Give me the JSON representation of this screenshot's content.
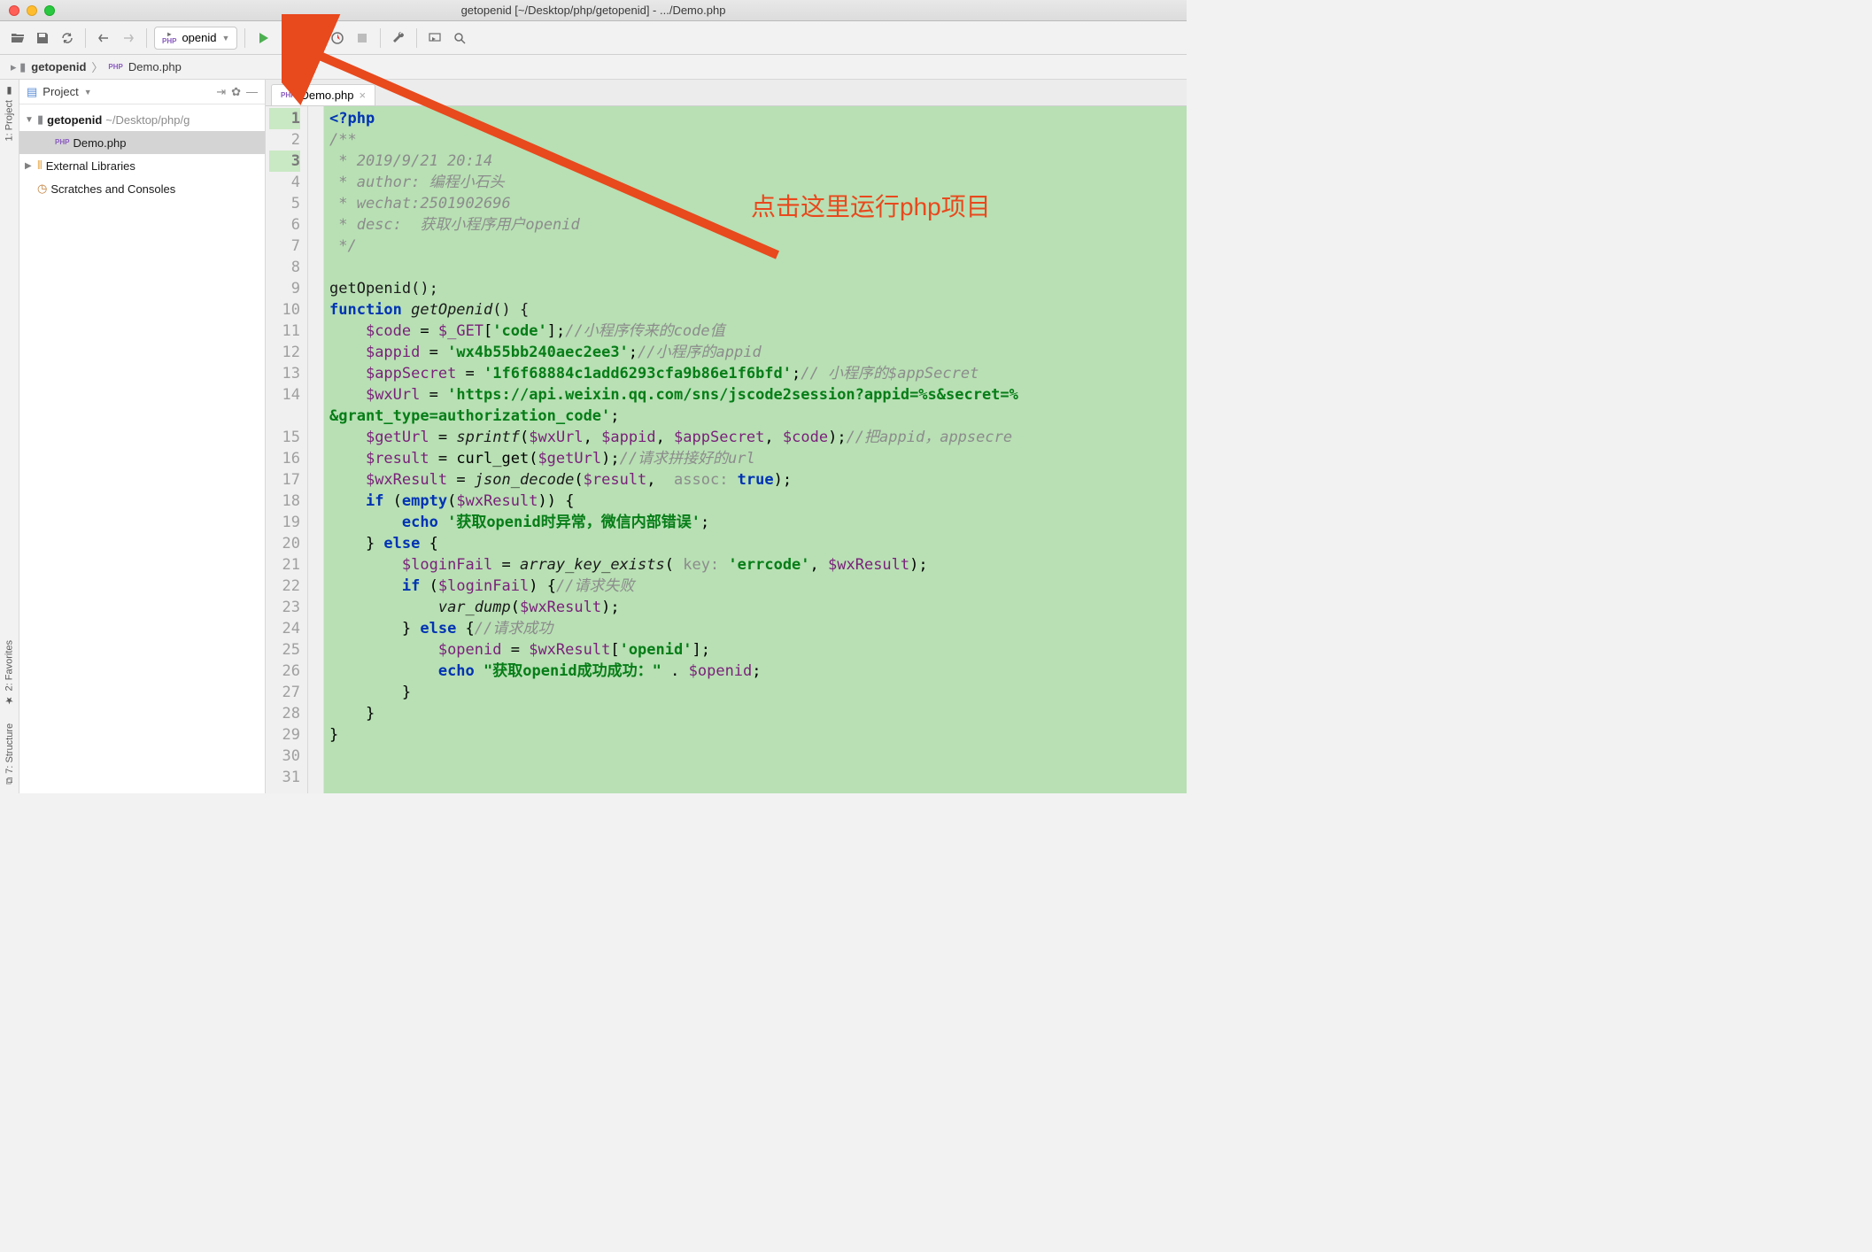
{
  "window": {
    "title": "getopenid [~/Desktop/php/getopenid] - .../Demo.php"
  },
  "toolbar": {
    "run_config": "openid"
  },
  "breadcrumb": {
    "root": "getopenid",
    "file": "Demo.php"
  },
  "project_panel": {
    "title": "Project",
    "root_name": "getopenid",
    "root_path": "~/Desktop/php/g",
    "file": "Demo.php",
    "ext_libs": "External Libraries",
    "scratches": "Scratches and Consoles"
  },
  "tab": {
    "name": "Demo.php"
  },
  "left_gutter": {
    "project": "1: Project",
    "favorites": "2: Favorites",
    "structure": "7: Structure"
  },
  "annotation": {
    "text": "点击这里运行php项目"
  },
  "lines": [
    {
      "n": 1,
      "hl": true,
      "seg": [
        {
          "t": "<?php",
          "c": "c-kw"
        }
      ]
    },
    {
      "n": 2,
      "seg": [
        {
          "t": "/**",
          "c": "c-cmt"
        }
      ]
    },
    {
      "n": 3,
      "hl": true,
      "seg": [
        {
          "t": " * 2019/9/21 20:14",
          "c": "c-cmt"
        }
      ]
    },
    {
      "n": 4,
      "seg": [
        {
          "t": " * author: 编程小石头",
          "c": "c-cmt"
        }
      ]
    },
    {
      "n": 5,
      "seg": [
        {
          "t": " * wechat:2501902696",
          "c": "c-cmt"
        }
      ]
    },
    {
      "n": 6,
      "seg": [
        {
          "t": " * desc:  获取小程序用户openid",
          "c": "c-cmt"
        }
      ]
    },
    {
      "n": 7,
      "seg": [
        {
          "t": " */",
          "c": "c-cmt"
        }
      ]
    },
    {
      "n": 8,
      "seg": []
    },
    {
      "n": 9,
      "seg": [
        {
          "t": "getOpenid();",
          "c": "c-punc"
        }
      ]
    },
    {
      "n": 10,
      "seg": [
        {
          "t": "function ",
          "c": "c-kw"
        },
        {
          "t": "getOpenid",
          "c": "c-fn"
        },
        {
          "t": "() {",
          "c": "c-punc"
        }
      ]
    },
    {
      "n": 11,
      "seg": [
        {
          "t": "    ",
          "c": ""
        },
        {
          "t": "$code",
          "c": "c-var"
        },
        {
          "t": " = ",
          "c": ""
        },
        {
          "t": "$_GET",
          "c": "c-var"
        },
        {
          "t": "[",
          "c": ""
        },
        {
          "t": "'code'",
          "c": "c-str"
        },
        {
          "t": "];",
          "c": ""
        },
        {
          "t": "//小程序传来的code值",
          "c": "c-cmt"
        }
      ]
    },
    {
      "n": 12,
      "seg": [
        {
          "t": "    ",
          "c": ""
        },
        {
          "t": "$appid",
          "c": "c-var"
        },
        {
          "t": " = ",
          "c": ""
        },
        {
          "t": "'wx4b55bb240aec2ee3'",
          "c": "c-str"
        },
        {
          "t": ";",
          "c": ""
        },
        {
          "t": "//小程序的appid",
          "c": "c-cmt"
        }
      ]
    },
    {
      "n": 13,
      "seg": [
        {
          "t": "    ",
          "c": ""
        },
        {
          "t": "$appSecret",
          "c": "c-var"
        },
        {
          "t": " = ",
          "c": ""
        },
        {
          "t": "'1f6f68884c1add6293cfa9b86e1f6bfd'",
          "c": "c-str"
        },
        {
          "t": ";",
          "c": ""
        },
        {
          "t": "// 小程序的$appSecret",
          "c": "c-cmt"
        }
      ]
    },
    {
      "n": 14,
      "seg": [
        {
          "t": "    ",
          "c": ""
        },
        {
          "t": "$wxUrl",
          "c": "c-var"
        },
        {
          "t": " = ",
          "c": ""
        },
        {
          "t": "'https://api.weixin.qq.com/sns/jscode2session?appid=%s&secret=%",
          "c": "c-str"
        }
      ]
    },
    {
      "n": 0,
      "seg": [
        {
          "t": "&grant_type=authorization_code'",
          "c": "c-str"
        },
        {
          "t": ";",
          "c": ""
        }
      ]
    },
    {
      "n": 15,
      "seg": [
        {
          "t": "    ",
          "c": ""
        },
        {
          "t": "$getUrl",
          "c": "c-var"
        },
        {
          "t": " = ",
          "c": ""
        },
        {
          "t": "sprintf",
          "c": "c-fn"
        },
        {
          "t": "(",
          "c": ""
        },
        {
          "t": "$wxUrl",
          "c": "c-var"
        },
        {
          "t": ", ",
          "c": ""
        },
        {
          "t": "$appid",
          "c": "c-var"
        },
        {
          "t": ", ",
          "c": ""
        },
        {
          "t": "$appSecret",
          "c": "c-var"
        },
        {
          "t": ", ",
          "c": ""
        },
        {
          "t": "$code",
          "c": "c-var"
        },
        {
          "t": ");",
          "c": ""
        },
        {
          "t": "//把appid，appsecre",
          "c": "c-cmt"
        }
      ]
    },
    {
      "n": 16,
      "seg": [
        {
          "t": "    ",
          "c": ""
        },
        {
          "t": "$result",
          "c": "c-var"
        },
        {
          "t": " = curl_get(",
          "c": ""
        },
        {
          "t": "$getUrl",
          "c": "c-var"
        },
        {
          "t": ");",
          "c": ""
        },
        {
          "t": "//请求拼接好的url",
          "c": "c-cmt"
        }
      ]
    },
    {
      "n": 17,
      "seg": [
        {
          "t": "    ",
          "c": ""
        },
        {
          "t": "$wxResult",
          "c": "c-var"
        },
        {
          "t": " = ",
          "c": ""
        },
        {
          "t": "json_decode",
          "c": "c-fn"
        },
        {
          "t": "(",
          "c": ""
        },
        {
          "t": "$result",
          "c": "c-var"
        },
        {
          "t": ",  ",
          "c": ""
        },
        {
          "t": "assoc: ",
          "c": "c-hint"
        },
        {
          "t": "true",
          "c": "c-kw"
        },
        {
          "t": ");",
          "c": ""
        }
      ]
    },
    {
      "n": 18,
      "seg": [
        {
          "t": "    ",
          "c": ""
        },
        {
          "t": "if ",
          "c": "c-kw"
        },
        {
          "t": "(",
          "c": ""
        },
        {
          "t": "empty",
          "c": "c-kw"
        },
        {
          "t": "(",
          "c": ""
        },
        {
          "t": "$wxResult",
          "c": "c-var"
        },
        {
          "t": ")) {",
          "c": ""
        }
      ]
    },
    {
      "n": 19,
      "seg": [
        {
          "t": "        ",
          "c": ""
        },
        {
          "t": "echo ",
          "c": "c-kw"
        },
        {
          "t": "'获取openid时异常，微信内部错误'",
          "c": "c-str"
        },
        {
          "t": ";",
          "c": ""
        }
      ]
    },
    {
      "n": 20,
      "seg": [
        {
          "t": "    } ",
          "c": ""
        },
        {
          "t": "else ",
          "c": "c-kw"
        },
        {
          "t": "{",
          "c": ""
        }
      ]
    },
    {
      "n": 21,
      "seg": [
        {
          "t": "        ",
          "c": ""
        },
        {
          "t": "$loginFail",
          "c": "c-var"
        },
        {
          "t": " = ",
          "c": ""
        },
        {
          "t": "array_key_exists",
          "c": "c-fn"
        },
        {
          "t": "( ",
          "c": ""
        },
        {
          "t": "key: ",
          "c": "c-hint"
        },
        {
          "t": "'errcode'",
          "c": "c-str"
        },
        {
          "t": ", ",
          "c": ""
        },
        {
          "t": "$wxResult",
          "c": "c-var"
        },
        {
          "t": ");",
          "c": ""
        }
      ]
    },
    {
      "n": 22,
      "seg": [
        {
          "t": "        ",
          "c": ""
        },
        {
          "t": "if ",
          "c": "c-kw"
        },
        {
          "t": "(",
          "c": ""
        },
        {
          "t": "$loginFail",
          "c": "c-var"
        },
        {
          "t": ") {",
          "c": ""
        },
        {
          "t": "//请求失败",
          "c": "c-cmt"
        }
      ]
    },
    {
      "n": 23,
      "seg": [
        {
          "t": "            ",
          "c": ""
        },
        {
          "t": "var_dump",
          "c": "c-fn"
        },
        {
          "t": "(",
          "c": ""
        },
        {
          "t": "$wxResult",
          "c": "c-var"
        },
        {
          "t": ");",
          "c": ""
        }
      ]
    },
    {
      "n": 24,
      "seg": [
        {
          "t": "        } ",
          "c": ""
        },
        {
          "t": "else ",
          "c": "c-kw"
        },
        {
          "t": "{",
          "c": ""
        },
        {
          "t": "//请求成功",
          "c": "c-cmt"
        }
      ]
    },
    {
      "n": 25,
      "seg": [
        {
          "t": "            ",
          "c": ""
        },
        {
          "t": "$openid",
          "c": "c-var"
        },
        {
          "t": " = ",
          "c": ""
        },
        {
          "t": "$wxResult",
          "c": "c-var"
        },
        {
          "t": "[",
          "c": ""
        },
        {
          "t": "'openid'",
          "c": "c-str"
        },
        {
          "t": "];",
          "c": ""
        }
      ]
    },
    {
      "n": 26,
      "seg": [
        {
          "t": "            ",
          "c": ""
        },
        {
          "t": "echo ",
          "c": "c-kw"
        },
        {
          "t": "\"获取openid成功成功：\"",
          "c": "c-str"
        },
        {
          "t": " . ",
          "c": ""
        },
        {
          "t": "$openid",
          "c": "c-var"
        },
        {
          "t": ";",
          "c": ""
        }
      ]
    },
    {
      "n": 27,
      "seg": [
        {
          "t": "        }",
          "c": ""
        }
      ]
    },
    {
      "n": 28,
      "seg": [
        {
          "t": "    }",
          "c": ""
        }
      ]
    },
    {
      "n": 29,
      "seg": [
        {
          "t": "}",
          "c": ""
        }
      ]
    },
    {
      "n": 30,
      "seg": []
    },
    {
      "n": 31,
      "seg": []
    }
  ]
}
